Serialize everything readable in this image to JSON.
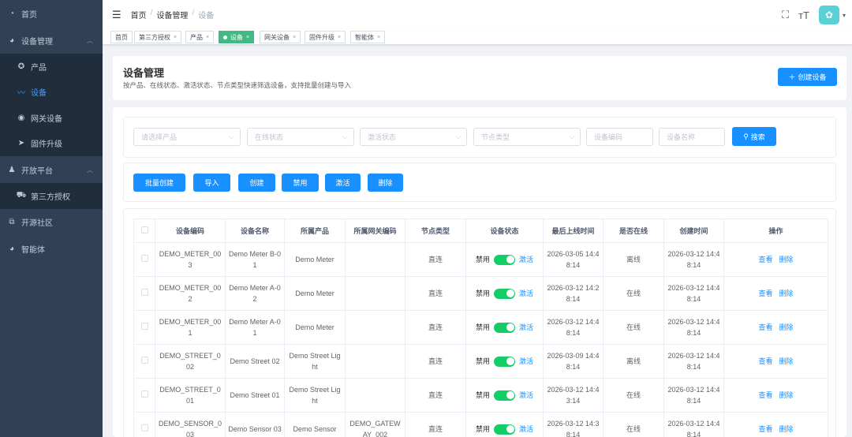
{
  "sidebar": {
    "items": [
      {
        "label": "首页",
        "icon": "dashboard-icon"
      },
      {
        "label": "设备管理",
        "icon": "device-manage-icon",
        "expanded": true
      },
      {
        "label": "产品",
        "icon": "product-icon"
      },
      {
        "label": "设备",
        "icon": "device-icon",
        "active": true
      },
      {
        "label": "网关设备",
        "icon": "gateway-icon"
      },
      {
        "label": "固件升级",
        "icon": "firmware-icon"
      },
      {
        "label": "开放平台",
        "icon": "open-platform-icon",
        "expanded": true
      },
      {
        "label": "第三方授权",
        "icon": "third-party-icon"
      },
      {
        "label": "开源社区",
        "icon": "community-icon"
      },
      {
        "label": "智能体",
        "icon": "agent-icon"
      }
    ]
  },
  "header": {
    "breadcrumb": [
      "首页",
      "设备管理",
      "设备"
    ]
  },
  "tags": [
    {
      "label": "首页",
      "closable": false
    },
    {
      "label": "第三方授权",
      "closable": true
    },
    {
      "label": "产品",
      "closable": true
    },
    {
      "label": "设备",
      "closable": true,
      "active": true
    },
    {
      "label": "网关设备",
      "closable": true
    },
    {
      "label": "固件升级",
      "closable": true
    },
    {
      "label": "智能体",
      "closable": true
    }
  ],
  "page": {
    "title": "设备管理",
    "subtitle": "按产品、在线状态、激活状态、节点类型快速筛选设备，支持批量创建与导入",
    "create_button": "创建设备"
  },
  "filters": {
    "product": "请选择产品",
    "online": "在线状态",
    "activation": "激活状态",
    "node_type": "节点类型",
    "device_code": "设备编码",
    "device_name": "设备名称",
    "search_button": "搜索"
  },
  "actions": [
    "批量创建",
    "导入",
    "创建",
    "禁用",
    "激活",
    "删除"
  ],
  "table": {
    "headers": [
      "设备编码",
      "设备名称",
      "所属产品",
      "所属网关编码",
      "节点类型",
      "设备状态",
      "最后上线时间",
      "是否在线",
      "创建时间",
      "操作"
    ],
    "status_labels": {
      "off": "禁用",
      "on": "激活"
    },
    "op_labels": {
      "view": "查看",
      "delete": "删除"
    },
    "rows": [
      {
        "code": "DEMO_METER_003",
        "name": "Demo Meter B-01",
        "product": "Demo Meter",
        "gateway": "",
        "node": "直连",
        "last_online": "2026-03-05 14:48:14",
        "online": "离线",
        "created": "2026-03-12 14:48:14"
      },
      {
        "code": "DEMO_METER_002",
        "name": "Demo Meter A-02",
        "product": "Demo Meter",
        "gateway": "",
        "node": "直连",
        "last_online": "2026-03-12 14:28:14",
        "online": "在线",
        "created": "2026-03-12 14:48:14"
      },
      {
        "code": "DEMO_METER_001",
        "name": "Demo Meter A-01",
        "product": "Demo Meter",
        "gateway": "",
        "node": "直连",
        "last_online": "2026-03-12 14:48:14",
        "online": "在线",
        "created": "2026-03-12 14:48:14"
      },
      {
        "code": "DEMO_STREET_002",
        "name": "Demo Street 02",
        "product": "Demo Street Light",
        "gateway": "",
        "node": "直连",
        "last_online": "2026-03-09 14:48:14",
        "online": "离线",
        "created": "2026-03-12 14:48:14"
      },
      {
        "code": "DEMO_STREET_001",
        "name": "Demo Street 01",
        "product": "Demo Street Light",
        "gateway": "",
        "node": "直连",
        "last_online": "2026-03-12 14:43:14",
        "online": "在线",
        "created": "2026-03-12 14:48:14"
      },
      {
        "code": "DEMO_SENSOR_003",
        "name": "Demo Sensor 03",
        "product": "Demo Sensor",
        "gateway": "DEMO_GATEWAY_002",
        "node": "直连",
        "last_online": "2026-03-12 14:38:14",
        "online": "在线",
        "created": "2026-03-12 14:48:14"
      }
    ]
  },
  "colors": {
    "sidebar_bg": "#304156",
    "sidebar_sub_bg": "#1f2d3d",
    "primary": "#1890ff",
    "tag_active": "#42b983",
    "switch_on": "#13ce66"
  }
}
